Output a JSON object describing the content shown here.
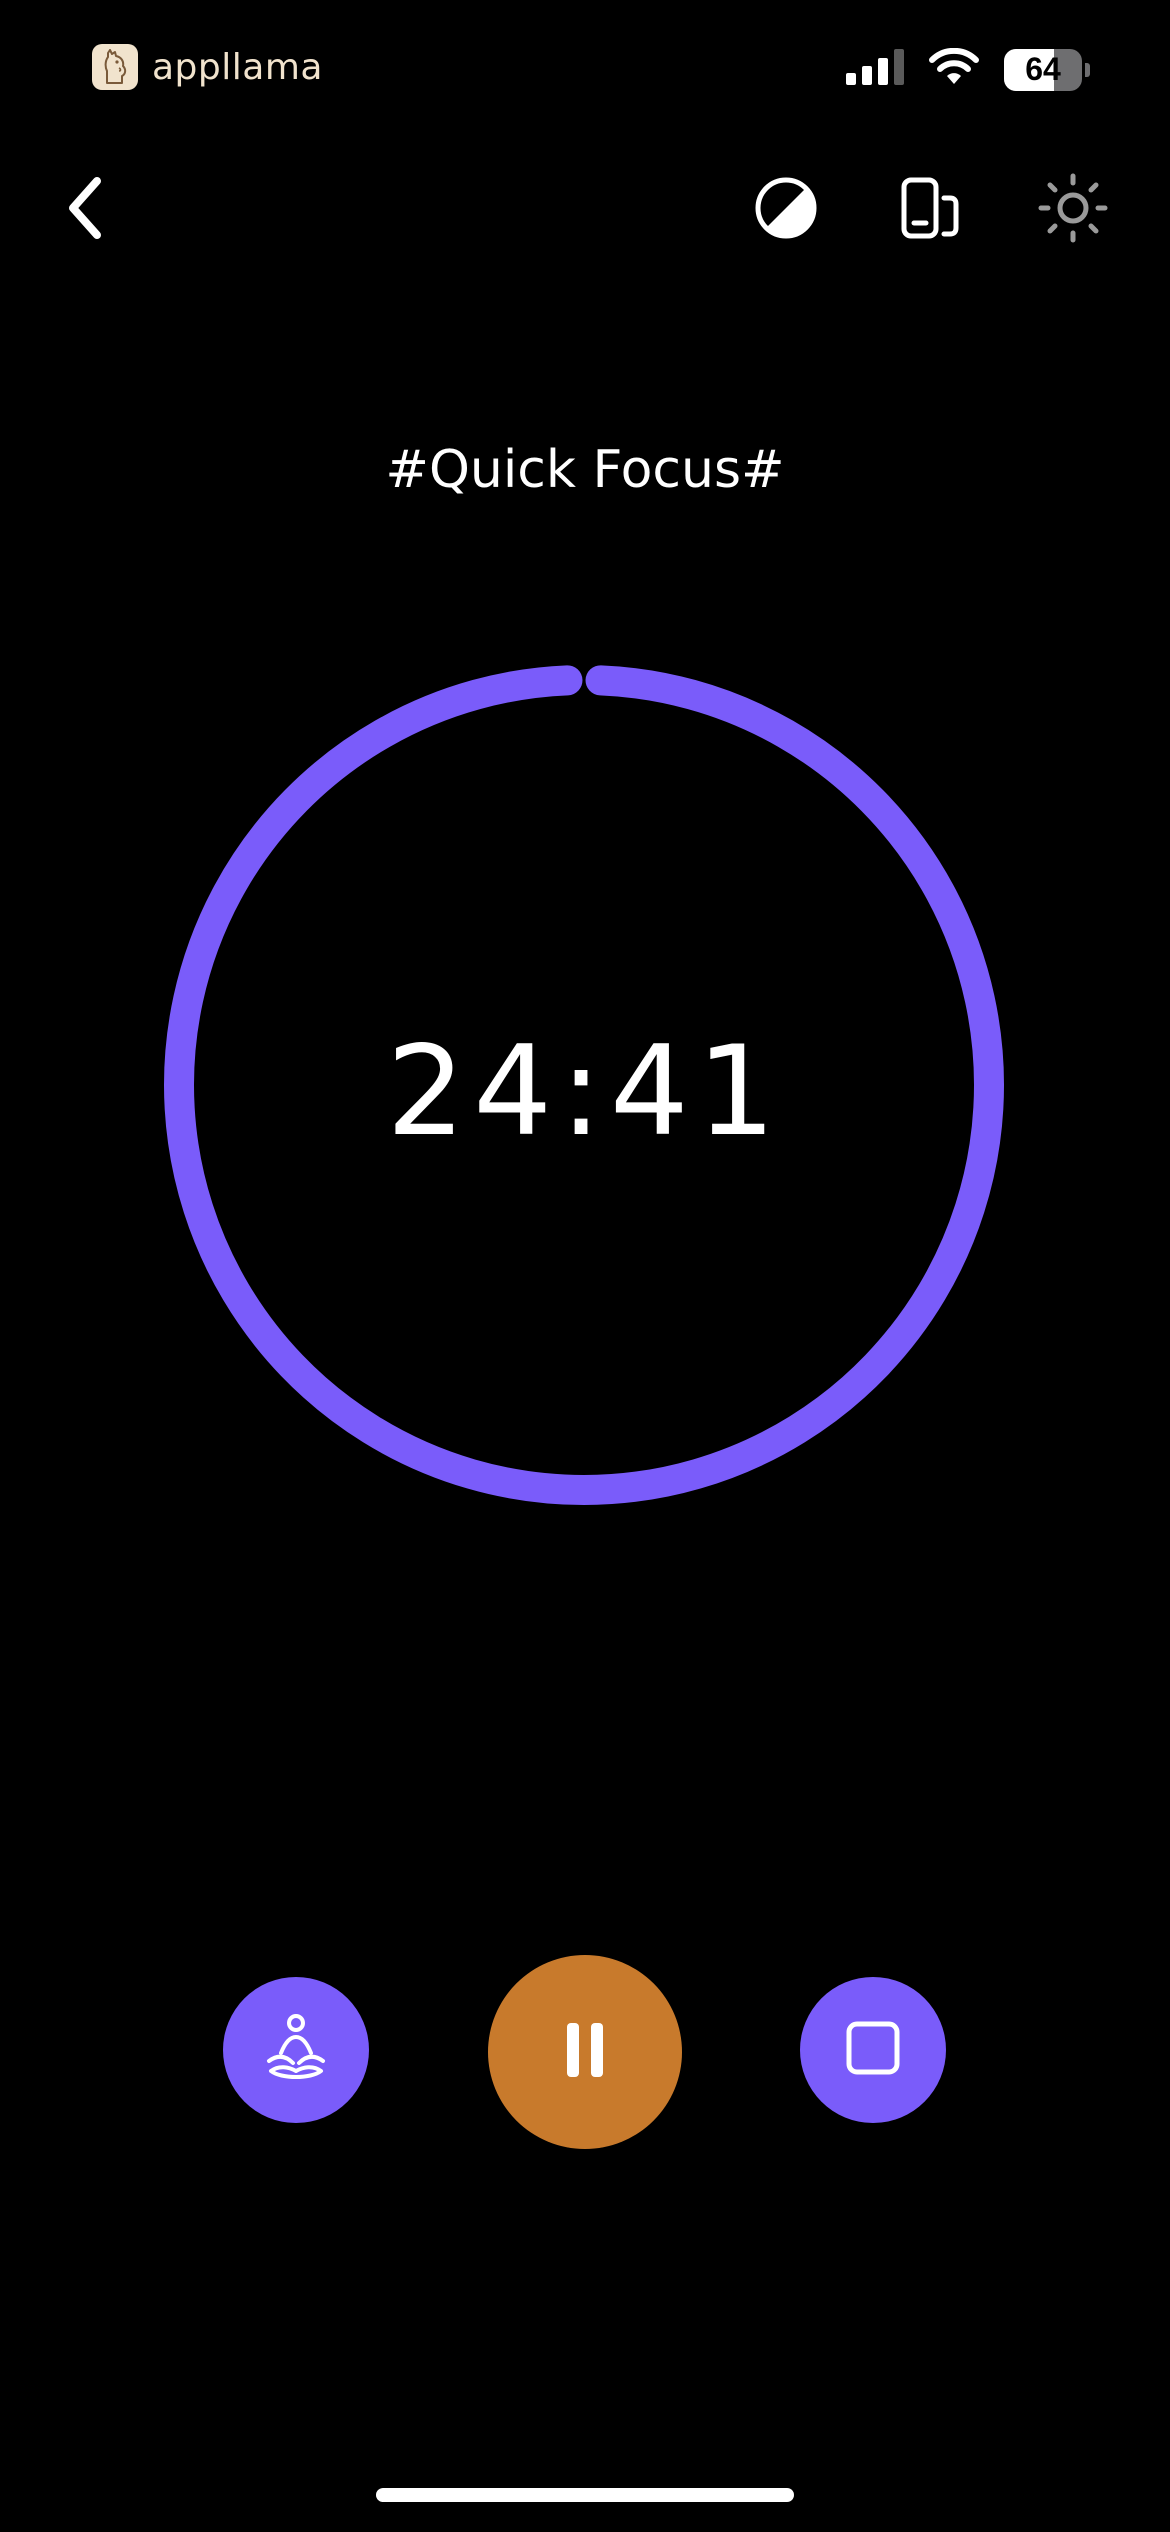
{
  "status_bar": {
    "brand_name": "appllama",
    "battery_level": "64",
    "battery_fraction": 0.64,
    "signal_icon": "cellular-signal-icon",
    "wifi_icon": "wifi-icon"
  },
  "toolbar": {
    "back_icon": "chevron-left-icon",
    "contrast_icon": "contrast-icon",
    "device_icon": "device-rotate-icon",
    "brightness_icon": "brightness-icon"
  },
  "session": {
    "title": "#Quick Focus#"
  },
  "timer": {
    "remaining": "24:41",
    "ring_color": "#7a5cfa",
    "progress_remaining_fraction": 0.987
  },
  "controls": {
    "meditate_icon": "meditation-icon",
    "pause_icon": "pause-icon",
    "stop_icon": "stop-icon",
    "primary_color": "#7a5cfa",
    "pause_color": "#c87a2c"
  }
}
